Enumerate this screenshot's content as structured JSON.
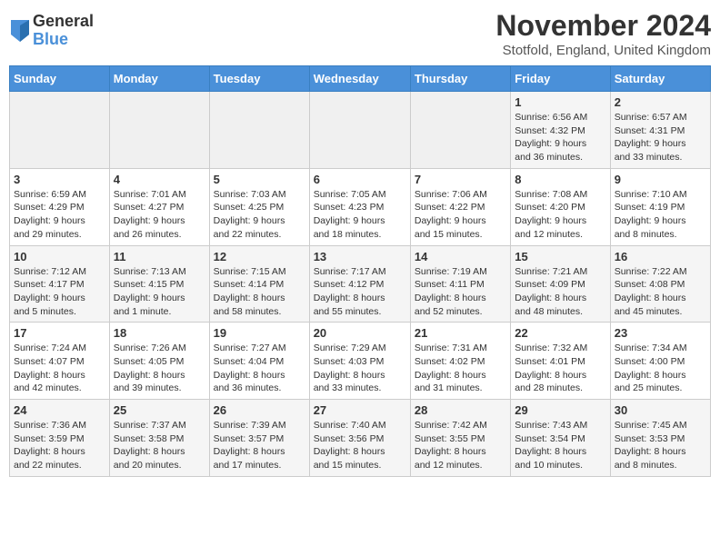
{
  "logo": {
    "general": "General",
    "blue": "Blue"
  },
  "title": "November 2024",
  "location": "Stotfold, England, United Kingdom",
  "days_of_week": [
    "Sunday",
    "Monday",
    "Tuesday",
    "Wednesday",
    "Thursday",
    "Friday",
    "Saturday"
  ],
  "weeks": [
    [
      {
        "day": "",
        "info": ""
      },
      {
        "day": "",
        "info": ""
      },
      {
        "day": "",
        "info": ""
      },
      {
        "day": "",
        "info": ""
      },
      {
        "day": "",
        "info": ""
      },
      {
        "day": "1",
        "info": "Sunrise: 6:56 AM\nSunset: 4:32 PM\nDaylight: 9 hours\nand 36 minutes."
      },
      {
        "day": "2",
        "info": "Sunrise: 6:57 AM\nSunset: 4:31 PM\nDaylight: 9 hours\nand 33 minutes."
      }
    ],
    [
      {
        "day": "3",
        "info": "Sunrise: 6:59 AM\nSunset: 4:29 PM\nDaylight: 9 hours\nand 29 minutes."
      },
      {
        "day": "4",
        "info": "Sunrise: 7:01 AM\nSunset: 4:27 PM\nDaylight: 9 hours\nand 26 minutes."
      },
      {
        "day": "5",
        "info": "Sunrise: 7:03 AM\nSunset: 4:25 PM\nDaylight: 9 hours\nand 22 minutes."
      },
      {
        "day": "6",
        "info": "Sunrise: 7:05 AM\nSunset: 4:23 PM\nDaylight: 9 hours\nand 18 minutes."
      },
      {
        "day": "7",
        "info": "Sunrise: 7:06 AM\nSunset: 4:22 PM\nDaylight: 9 hours\nand 15 minutes."
      },
      {
        "day": "8",
        "info": "Sunrise: 7:08 AM\nSunset: 4:20 PM\nDaylight: 9 hours\nand 12 minutes."
      },
      {
        "day": "9",
        "info": "Sunrise: 7:10 AM\nSunset: 4:19 PM\nDaylight: 9 hours\nand 8 minutes."
      }
    ],
    [
      {
        "day": "10",
        "info": "Sunrise: 7:12 AM\nSunset: 4:17 PM\nDaylight: 9 hours\nand 5 minutes."
      },
      {
        "day": "11",
        "info": "Sunrise: 7:13 AM\nSunset: 4:15 PM\nDaylight: 9 hours\nand 1 minute."
      },
      {
        "day": "12",
        "info": "Sunrise: 7:15 AM\nSunset: 4:14 PM\nDaylight: 8 hours\nand 58 minutes."
      },
      {
        "day": "13",
        "info": "Sunrise: 7:17 AM\nSunset: 4:12 PM\nDaylight: 8 hours\nand 55 minutes."
      },
      {
        "day": "14",
        "info": "Sunrise: 7:19 AM\nSunset: 4:11 PM\nDaylight: 8 hours\nand 52 minutes."
      },
      {
        "day": "15",
        "info": "Sunrise: 7:21 AM\nSunset: 4:09 PM\nDaylight: 8 hours\nand 48 minutes."
      },
      {
        "day": "16",
        "info": "Sunrise: 7:22 AM\nSunset: 4:08 PM\nDaylight: 8 hours\nand 45 minutes."
      }
    ],
    [
      {
        "day": "17",
        "info": "Sunrise: 7:24 AM\nSunset: 4:07 PM\nDaylight: 8 hours\nand 42 minutes."
      },
      {
        "day": "18",
        "info": "Sunrise: 7:26 AM\nSunset: 4:05 PM\nDaylight: 8 hours\nand 39 minutes."
      },
      {
        "day": "19",
        "info": "Sunrise: 7:27 AM\nSunset: 4:04 PM\nDaylight: 8 hours\nand 36 minutes."
      },
      {
        "day": "20",
        "info": "Sunrise: 7:29 AM\nSunset: 4:03 PM\nDaylight: 8 hours\nand 33 minutes."
      },
      {
        "day": "21",
        "info": "Sunrise: 7:31 AM\nSunset: 4:02 PM\nDaylight: 8 hours\nand 31 minutes."
      },
      {
        "day": "22",
        "info": "Sunrise: 7:32 AM\nSunset: 4:01 PM\nDaylight: 8 hours\nand 28 minutes."
      },
      {
        "day": "23",
        "info": "Sunrise: 7:34 AM\nSunset: 4:00 PM\nDaylight: 8 hours\nand 25 minutes."
      }
    ],
    [
      {
        "day": "24",
        "info": "Sunrise: 7:36 AM\nSunset: 3:59 PM\nDaylight: 8 hours\nand 22 minutes."
      },
      {
        "day": "25",
        "info": "Sunrise: 7:37 AM\nSunset: 3:58 PM\nDaylight: 8 hours\nand 20 minutes."
      },
      {
        "day": "26",
        "info": "Sunrise: 7:39 AM\nSunset: 3:57 PM\nDaylight: 8 hours\nand 17 minutes."
      },
      {
        "day": "27",
        "info": "Sunrise: 7:40 AM\nSunset: 3:56 PM\nDaylight: 8 hours\nand 15 minutes."
      },
      {
        "day": "28",
        "info": "Sunrise: 7:42 AM\nSunset: 3:55 PM\nDaylight: 8 hours\nand 12 minutes."
      },
      {
        "day": "29",
        "info": "Sunrise: 7:43 AM\nSunset: 3:54 PM\nDaylight: 8 hours\nand 10 minutes."
      },
      {
        "day": "30",
        "info": "Sunrise: 7:45 AM\nSunset: 3:53 PM\nDaylight: 8 hours\nand 8 minutes."
      }
    ]
  ]
}
